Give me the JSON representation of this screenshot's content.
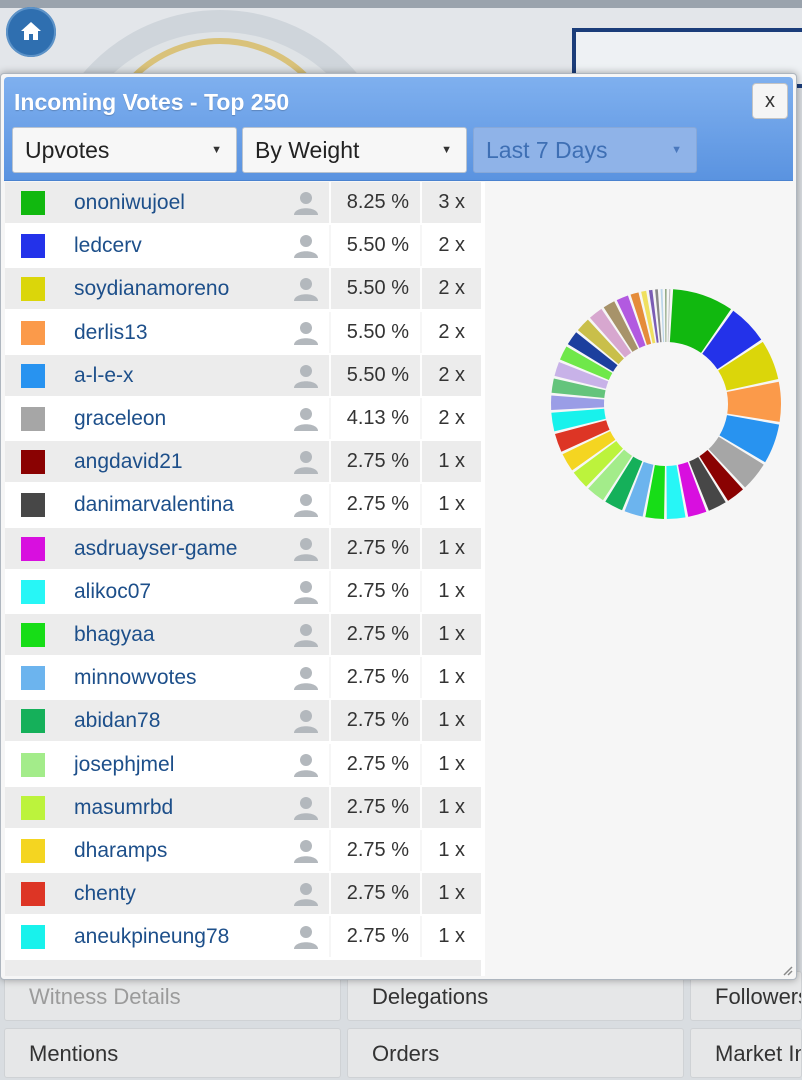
{
  "modal": {
    "title": "Incoming Votes - Top 250",
    "close_label": "x",
    "filters": {
      "vote_type": "Upvotes",
      "sort": "By Weight",
      "period": "Last 7 Days"
    }
  },
  "voters": [
    {
      "name": "ononiwujoel",
      "percent": "8.25 %",
      "count": "3 x",
      "color": "#11b80f"
    },
    {
      "name": "ledcerv",
      "percent": "5.50 %",
      "count": "2 x",
      "color": "#2332ea"
    },
    {
      "name": "soydianamoreno",
      "percent": "5.50 %",
      "count": "2 x",
      "color": "#dbd60a"
    },
    {
      "name": "derlis13",
      "percent": "5.50 %",
      "count": "2 x",
      "color": "#fb9a4a"
    },
    {
      "name": "a-l-e-x",
      "percent": "5.50 %",
      "count": "2 x",
      "color": "#2893f0"
    },
    {
      "name": "graceleon",
      "percent": "4.13 %",
      "count": "2 x",
      "color": "#a6a6a6"
    },
    {
      "name": "angdavid21",
      "percent": "2.75 %",
      "count": "1 x",
      "color": "#8a0202"
    },
    {
      "name": "danimarvalentina",
      "percent": "2.75 %",
      "count": "1 x",
      "color": "#474747"
    },
    {
      "name": "asdruayser-game",
      "percent": "2.75 %",
      "count": "1 x",
      "color": "#d80fdf"
    },
    {
      "name": "alikoc07",
      "percent": "2.75 %",
      "count": "1 x",
      "color": "#27f6f6"
    },
    {
      "name": "bhagyaa",
      "percent": "2.75 %",
      "count": "1 x",
      "color": "#17dd17"
    },
    {
      "name": "minnowvotes",
      "percent": "2.75 %",
      "count": "1 x",
      "color": "#6cb4ee"
    },
    {
      "name": "abidan78",
      "percent": "2.75 %",
      "count": "1 x",
      "color": "#15b05a"
    },
    {
      "name": "josephjmel",
      "percent": "2.75 %",
      "count": "1 x",
      "color": "#a3ec8a"
    },
    {
      "name": "masumrbd",
      "percent": "2.75 %",
      "count": "1 x",
      "color": "#bcf33c"
    },
    {
      "name": "dharamps",
      "percent": "2.75 %",
      "count": "1 x",
      "color": "#f4d521"
    },
    {
      "name": "chenty",
      "percent": "2.75 %",
      "count": "1 x",
      "color": "#dd3525"
    },
    {
      "name": "aneukpineung78",
      "percent": "2.75 %",
      "count": "1 x",
      "color": "#18f2ec"
    }
  ],
  "chart_data": {
    "type": "pie",
    "style": "donut",
    "slices": [
      {
        "label": "ononiwujoel",
        "value": 8.25,
        "color": "#11b80f"
      },
      {
        "label": "ledcerv",
        "value": 5.5,
        "color": "#2332ea"
      },
      {
        "label": "soydianamoreno",
        "value": 5.5,
        "color": "#dbd60a"
      },
      {
        "label": "derlis13",
        "value": 5.5,
        "color": "#fb9a4a"
      },
      {
        "label": "a-l-e-x",
        "value": 5.5,
        "color": "#2893f0"
      },
      {
        "label": "graceleon",
        "value": 4.13,
        "color": "#a6a6a6"
      },
      {
        "label": "angdavid21",
        "value": 2.75,
        "color": "#8a0202"
      },
      {
        "label": "danimarvalentina",
        "value": 2.75,
        "color": "#474747"
      },
      {
        "label": "asdruayser-game",
        "value": 2.75,
        "color": "#d80fdf"
      },
      {
        "label": "alikoc07",
        "value": 2.75,
        "color": "#27f6f6"
      },
      {
        "label": "bhagyaa",
        "value": 2.75,
        "color": "#17dd17"
      },
      {
        "label": "minnowvotes",
        "value": 2.75,
        "color": "#6cb4ee"
      },
      {
        "label": "abidan78",
        "value": 2.75,
        "color": "#15b05a"
      },
      {
        "label": "josephjmel",
        "value": 2.75,
        "color": "#a3ec8a"
      },
      {
        "label": "masumrbd",
        "value": 2.75,
        "color": "#bcf33c"
      },
      {
        "label": "dharamps",
        "value": 2.75,
        "color": "#f4d521"
      },
      {
        "label": "chenty",
        "value": 2.75,
        "color": "#dd3525"
      },
      {
        "label": "aneukpineung78",
        "value": 2.75,
        "color": "#18f2ec"
      },
      {
        "label": "",
        "value": 2.2,
        "color": "#9a9de6"
      },
      {
        "label": "",
        "value": 2.2,
        "color": "#64c47c"
      },
      {
        "label": "",
        "value": 2.2,
        "color": "#c8b2e8"
      },
      {
        "label": "",
        "value": 2.2,
        "color": "#6fe84a"
      },
      {
        "label": "",
        "value": 2.2,
        "color": "#1c3f9e"
      },
      {
        "label": "",
        "value": 2.2,
        "color": "#c9bf4a"
      },
      {
        "label": "",
        "value": 2.2,
        "color": "#d7a7cf"
      },
      {
        "label": "",
        "value": 1.9,
        "color": "#a7936a"
      },
      {
        "label": "",
        "value": 1.9,
        "color": "#b25ae0"
      },
      {
        "label": "",
        "value": 1.4,
        "color": "#e58c3a"
      },
      {
        "label": "",
        "value": 1.0,
        "color": "#f0e060"
      },
      {
        "label": "",
        "value": 0.8,
        "color": "#7a5cb4"
      },
      {
        "label": "",
        "value": 0.7,
        "color": "#888888"
      },
      {
        "label": "",
        "value": 0.6,
        "color": "#bcd6ea"
      },
      {
        "label": "",
        "value": 0.5,
        "color": "#6a8a5a"
      },
      {
        "label": "",
        "value": 0.5,
        "color": "#c0c0c0"
      }
    ]
  },
  "background": {
    "buttons": [
      "Witness Details",
      "Delegations",
      "Followers",
      "Mentions",
      "Orders",
      "Market Info"
    ]
  },
  "icons": {
    "home": "home-icon",
    "voter": "person-icon"
  }
}
